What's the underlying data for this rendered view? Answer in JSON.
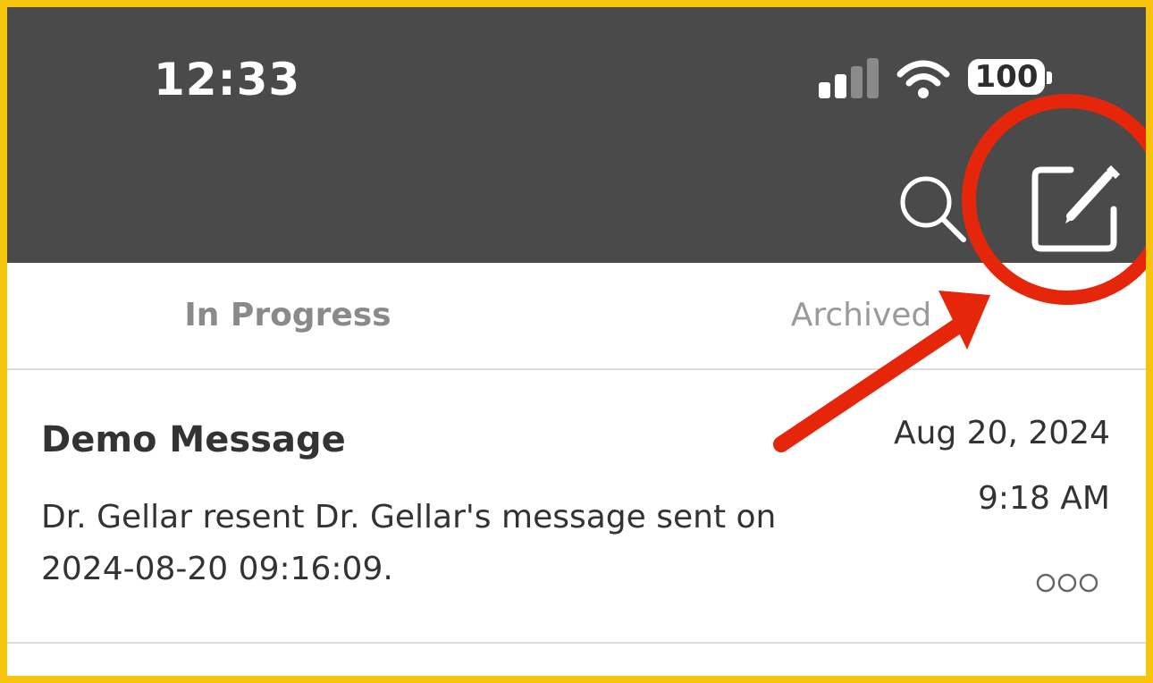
{
  "status_bar": {
    "time": "12:33",
    "battery": "100",
    "icons": {
      "signal": "cellular-signal-icon",
      "wifi": "wifi-icon",
      "battery": "battery-icon"
    }
  },
  "header": {
    "search_icon": "search-icon",
    "compose_icon": "compose-icon"
  },
  "tabs": [
    {
      "label": "In Progress",
      "active": true
    },
    {
      "label": "Archived",
      "active": false
    }
  ],
  "messages": [
    {
      "title": "Demo Message",
      "body": "Dr. Gellar resent Dr. Gellar's message sent on 2024-08-20 09:16:09.",
      "date": "Aug 20, 2024",
      "time": "9:18 AM",
      "more_icon": "more-options-icon"
    }
  ],
  "colors": {
    "header": "#4a4a4a",
    "frame": "#f7c40e",
    "annotation": "#e5260a"
  }
}
